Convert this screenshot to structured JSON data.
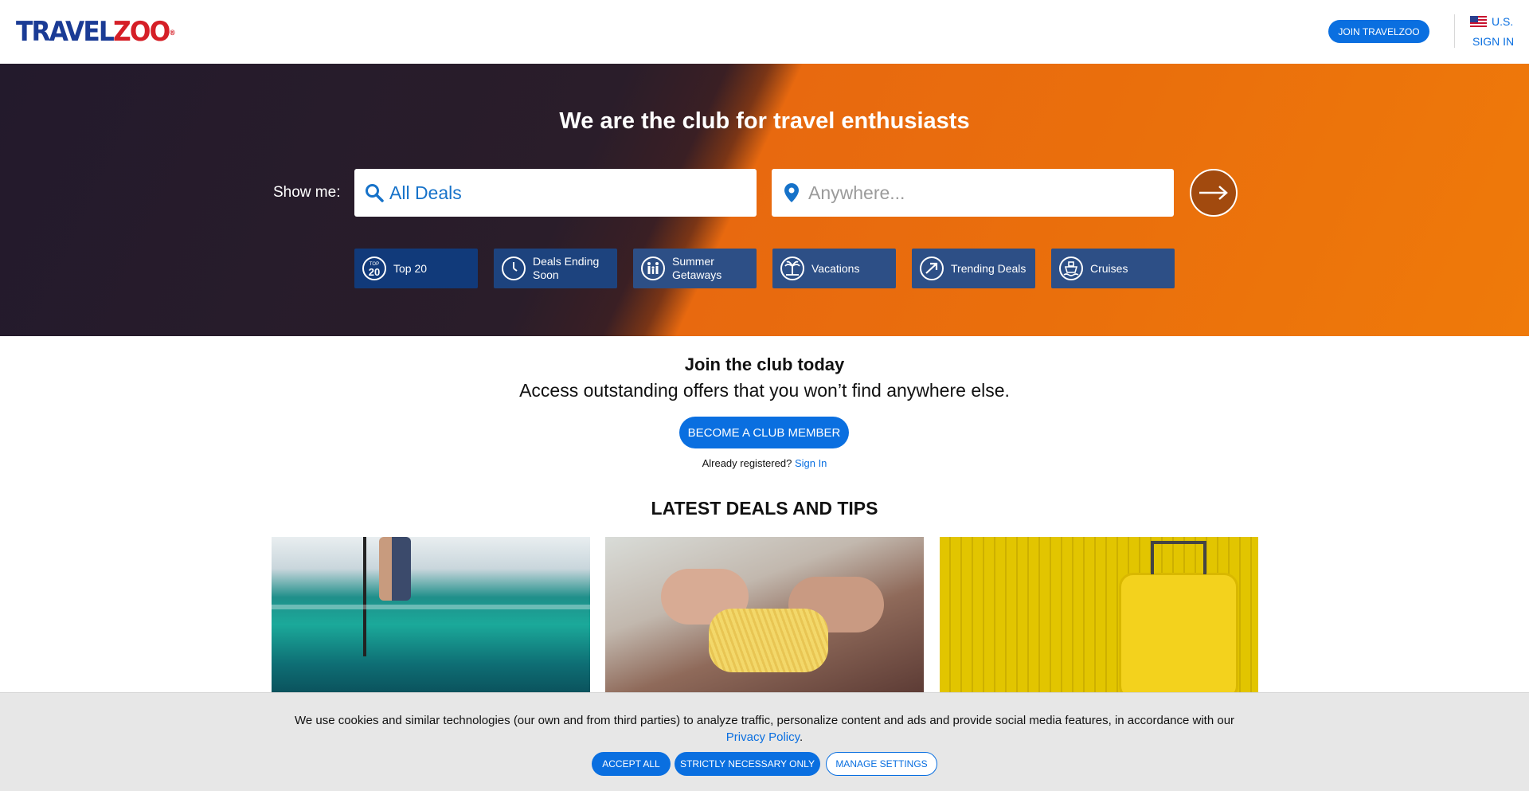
{
  "header": {
    "logo_travel": "TRAVEL",
    "logo_zoo": "ZOO",
    "logo_reg": "®",
    "join_label": "JOIN TRAVELZOO",
    "country": "U.S.",
    "sign_in": "SIGN IN"
  },
  "hero": {
    "title": "We are the club for travel enthusiasts",
    "show_me": "Show me:",
    "deals_value": "All Deals",
    "where_placeholder": "Anywhere...",
    "chips": [
      {
        "label": "Top 20",
        "icon": "top20-icon",
        "icon_text": "20"
      },
      {
        "label": "Deals Ending Soon",
        "icon": "clock-icon"
      },
      {
        "label": "Summer Getaways",
        "icon": "family-icon"
      },
      {
        "label": "Vacations",
        "icon": "palm-tree-icon"
      },
      {
        "label": "Trending Deals",
        "icon": "trending-arrow-icon"
      },
      {
        "label": "Cruises",
        "icon": "ship-icon"
      }
    ],
    "top20_small": "TOP"
  },
  "join": {
    "title": "Join the club today",
    "subtitle": "Access outstanding offers that you won’t find anywhere else.",
    "member_button": "BECOME A CLUB MEMBER",
    "already": "Already registered?",
    "sign_in": "Sign In"
  },
  "latest": {
    "title": "LATEST DEALS AND TIPS"
  },
  "cookie": {
    "text": "We use cookies and similar technologies (our own and from third parties) to analyze traffic, personalize content and ads and provide social media features, in accordance with our",
    "policy_link": "Privacy Policy",
    "period": ".",
    "accept": "ACCEPT ALL",
    "strict": "STRICTLY NECESSARY ONLY",
    "manage": "MANAGE SETTINGS"
  },
  "colors": {
    "accent": "#0a6fe0",
    "logo_blue": "#1a3b95",
    "logo_red": "#d51f27",
    "hero_orange": "#ea6f0c",
    "hero_dark": "#231a2c",
    "chip_blue": "#2d4f86"
  }
}
